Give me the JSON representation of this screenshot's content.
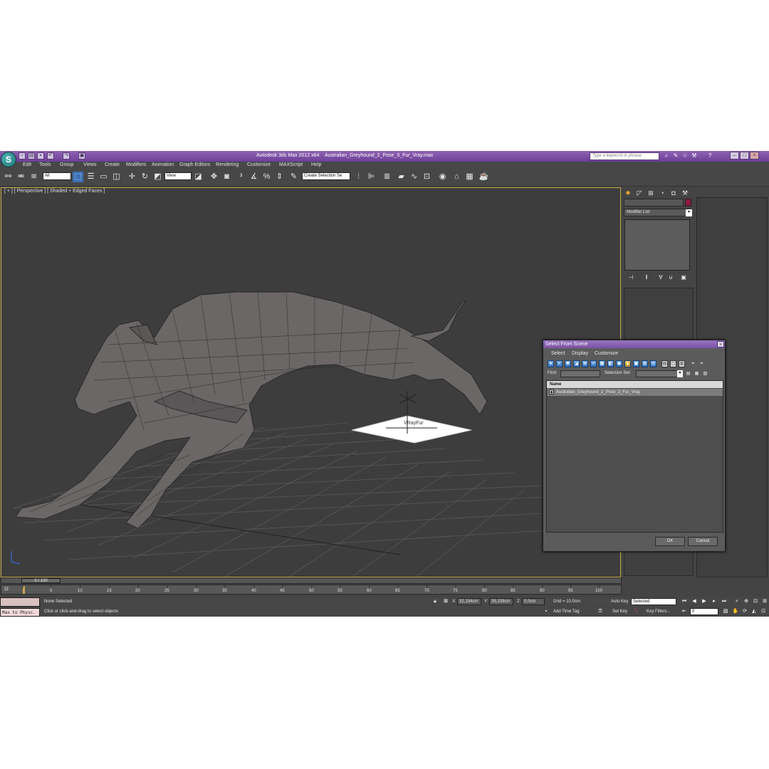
{
  "titlebar": {
    "app_title": "Autodesk 3ds Max  2012 x64",
    "file_name": "Australian_Greyhound_2_Pose_3_Fur_Vray.max",
    "search_placeholder": "Type a keyword or phrase"
  },
  "menu": [
    "Edit",
    "Tools",
    "Group",
    "Views",
    "Create",
    "Modifiers",
    "Animation",
    "Graph Editors",
    "Rendering",
    "Customize",
    "MAXScript",
    "Help"
  ],
  "toolbar": {
    "filter_value": "All",
    "coord_system": "View",
    "selection_set": "Create Selection Se"
  },
  "viewport": {
    "label": "[ + ] [ Perspective ] [ Shaded + Edged Faces ]",
    "object_label": "VRayFur"
  },
  "command_panel": {
    "modifier_list": "Modifier List"
  },
  "dialog": {
    "title": "Select From Scene",
    "menu": [
      "Select",
      "Display",
      "Customize"
    ],
    "find_label": "Find:",
    "selection_set_label": "Selection Set:",
    "column_name": "Name",
    "rows": [
      "Australian_Greyhound_2_Pose_3_Fur_Vray"
    ],
    "ok_label": "OK",
    "cancel_label": "Cancel"
  },
  "timeline": {
    "frame_display": "0 / 100",
    "ticks": [
      "5",
      "10",
      "15",
      "20",
      "25",
      "30",
      "35",
      "40",
      "45",
      "50",
      "55",
      "60",
      "65",
      "70",
      "75",
      "80",
      "85",
      "90",
      "95",
      "100"
    ]
  },
  "status": {
    "maxscript_text": "Max to Physc.",
    "selection_status": "None Selected",
    "prompt": "Click or click-and-drag to select objects",
    "x_label": "X:",
    "x_value": "32,154cm",
    "y_label": "Y:",
    "y_value": "39,109cm",
    "z_label": "Z:",
    "z_value": "0,0cm",
    "grid": "Grid = 10,0cm",
    "add_time_tag": "Add Time Tag",
    "auto_key": "Auto Key",
    "set_key": "Set Key",
    "key_mode": "Selected",
    "key_filters": "Key Filters...",
    "current_frame": "0"
  }
}
